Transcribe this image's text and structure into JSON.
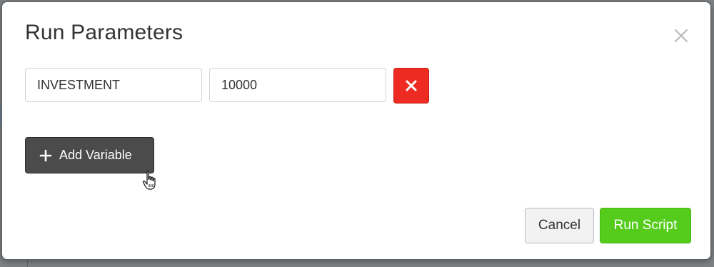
{
  "modal": {
    "title": "Run Parameters",
    "close_icon": "close-icon"
  },
  "parameters": [
    {
      "name": "INVESTMENT",
      "value": "10000",
      "delete_icon": "x-icon"
    }
  ],
  "actions": {
    "add_variable_label": "Add Variable",
    "add_icon": "plus-icon",
    "cancel_label": "Cancel",
    "run_label": "Run Script"
  },
  "colors": {
    "delete_button": "#ee2b22",
    "add_button": "#4b4b4b",
    "run_button": "#55cc1c",
    "cancel_button": "#f2f2f2",
    "title_text": "#333333"
  }
}
